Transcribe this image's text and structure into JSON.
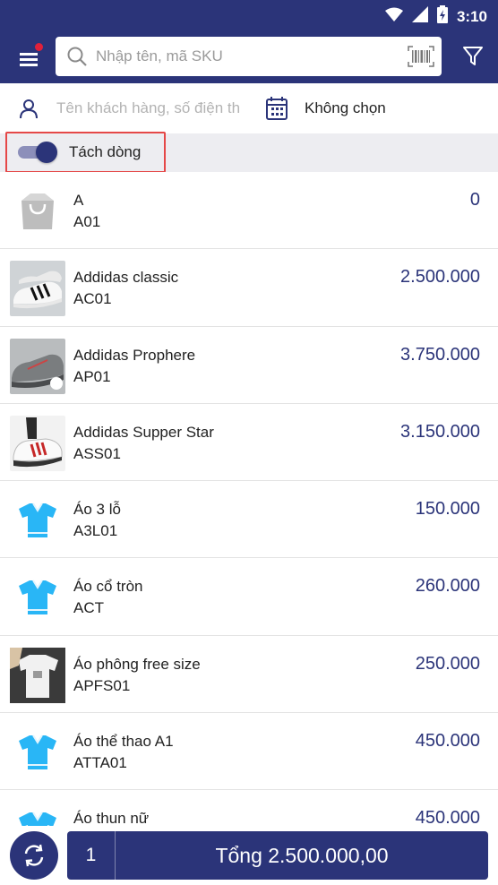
{
  "status_bar": {
    "time": "3:10"
  },
  "app_bar": {
    "search_placeholder": "Nhập tên, mã SKU"
  },
  "customer": {
    "placeholder": "Tên khách hàng, số điện th",
    "price_book": "Không chọn"
  },
  "split_line": {
    "label": "Tách dòng",
    "enabled": true
  },
  "colors": {
    "primary": "#2b3479",
    "highlight": "#e54848",
    "shirt": "#29b6f6"
  },
  "products": [
    {
      "name": "A",
      "sku": "A01",
      "price": "0",
      "thumb": "bag-icon"
    },
    {
      "name": "Addidas classic",
      "sku": "AC01",
      "price": "2.500.000",
      "thumb": "shoe-photo"
    },
    {
      "name": "Addidas Prophere",
      "sku": "AP01",
      "price": "3.750.000",
      "thumb": "shoe-photo"
    },
    {
      "name": "Addidas Supper Star",
      "sku": "ASS01",
      "price": "3.150.000",
      "thumb": "shoe-photo"
    },
    {
      "name": "Áo 3 lỗ",
      "sku": "A3L01",
      "price": "150.000",
      "thumb": "shirt-icon"
    },
    {
      "name": "Áo cổ tròn",
      "sku": "ACT",
      "price": "260.000",
      "thumb": "shirt-icon"
    },
    {
      "name": "Áo phông free size",
      "sku": "APFS01",
      "price": "250.000",
      "thumb": "clothing-photo"
    },
    {
      "name": "Áo thể thao A1",
      "sku": "ATTA01",
      "price": "450.000",
      "thumb": "shirt-icon"
    },
    {
      "name": "Áo thun nữ",
      "sku": "",
      "price": "450.000",
      "thumb": "shirt-icon"
    }
  ],
  "bottom_bar": {
    "quantity": "1",
    "total_label": "Tổng 2.500.000,00"
  }
}
